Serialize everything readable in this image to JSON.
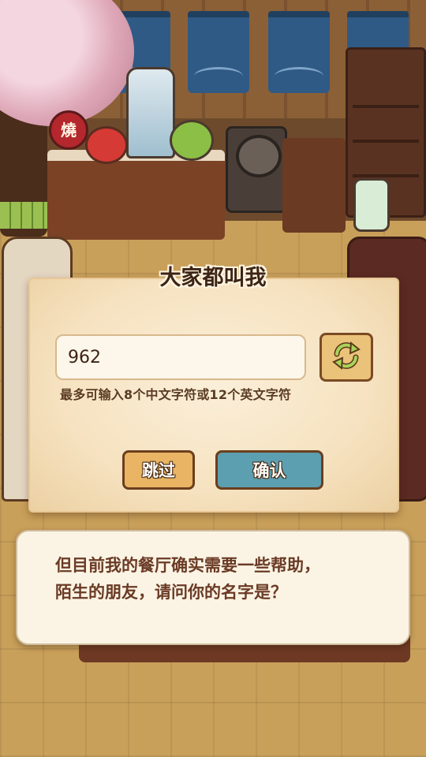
{
  "scene": {
    "lantern_char": "燒"
  },
  "name_dialog": {
    "title": "大家都叫我",
    "name_value": "962",
    "hint": "最多可输入8个中文字符或12个英文字符",
    "refresh_icon": "refresh-arrows-icon",
    "skip_label": "跳过",
    "confirm_label": "确认"
  },
  "dialogue": {
    "line1": "但目前我的餐厅确实需要一些帮助，",
    "line2": "陌生的朋友，请问你的名字是？"
  },
  "colors": {
    "panel_bg": "#f6e2c0",
    "skip_button": "#e9b565",
    "confirm_button": "#5c9fb0",
    "refresh_button": "#ebc27a",
    "dialogue_text": "#6a3a25"
  }
}
